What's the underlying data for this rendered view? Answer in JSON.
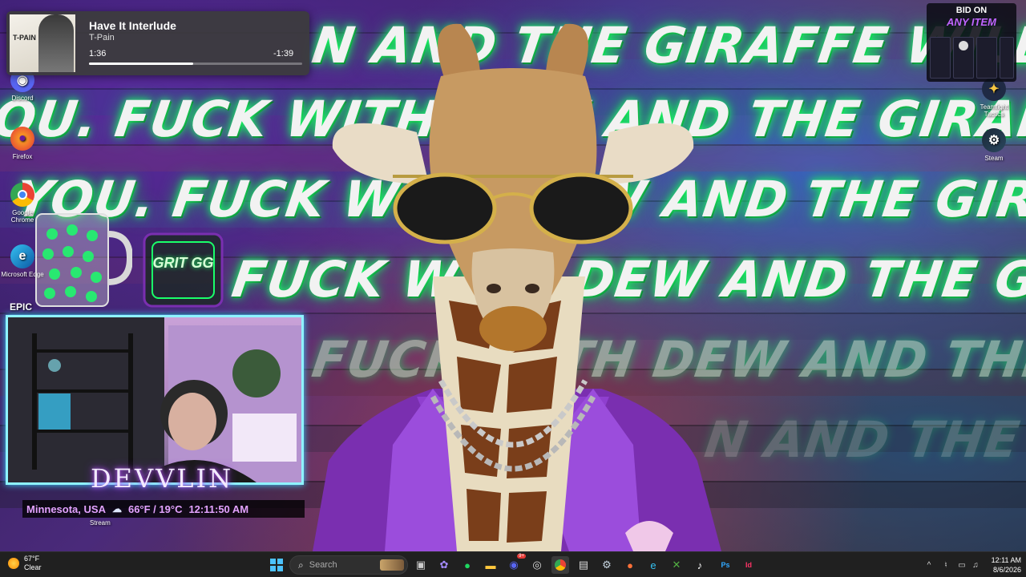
{
  "media": {
    "title": "Have It Interlude",
    "artist": "T-Pain",
    "elapsed": "1:36",
    "remaining": "-1:39",
    "progress": 0.49,
    "album_label": "T-PAIN"
  },
  "wallpaper": {
    "slogan_1": "N AND THE GIRAFFE WILL FIND",
    "slogan_2": "OU. FUCK WITH DEW AND THE GIRAFFE WILL FIND Y",
    "slogan_3": "YOU. FUCK WITH DEW AND THE GIRAFFE WILL FIN",
    "slogan_4": "FUCK WITH DEW AND THE GIRAFFE WIL",
    "slogan_5": "FUCK WITH DEW AND THE GIRAFFE",
    "slogan_6": "N AND THE GIRA"
  },
  "desktop_icons": {
    "discord": "Discord",
    "firefox": "Firefox",
    "chrome": "Google Chrome",
    "edge": "Microsoft Edge",
    "epic": "EPIC",
    "teamfight": "Teamfight Tactics",
    "steam": "Steam",
    "obs_stream": "Stream"
  },
  "overlay": {
    "mug_label": "",
    "gg_badge": "GRIT GG",
    "streamer_name": "DEVVLIN",
    "location": "Minnesota, USA",
    "weather": "66°F / 19°C",
    "time": "12:11:50 AM"
  },
  "bid": {
    "line1": "BID ON",
    "line2": "ANY ITEM"
  },
  "taskbar": {
    "weather_temp": "67°F",
    "weather_cond": "Clear",
    "search_placeholder": "Search",
    "time": "12:11 AM",
    "date": "8/6/2026",
    "discord_badge": "9+"
  },
  "colors": {
    "slogan_glow": "#1aff6a",
    "webcam_border": "#8ef3ff",
    "accent_purple": "#c064ff",
    "taskbar_bg": "#202020"
  }
}
